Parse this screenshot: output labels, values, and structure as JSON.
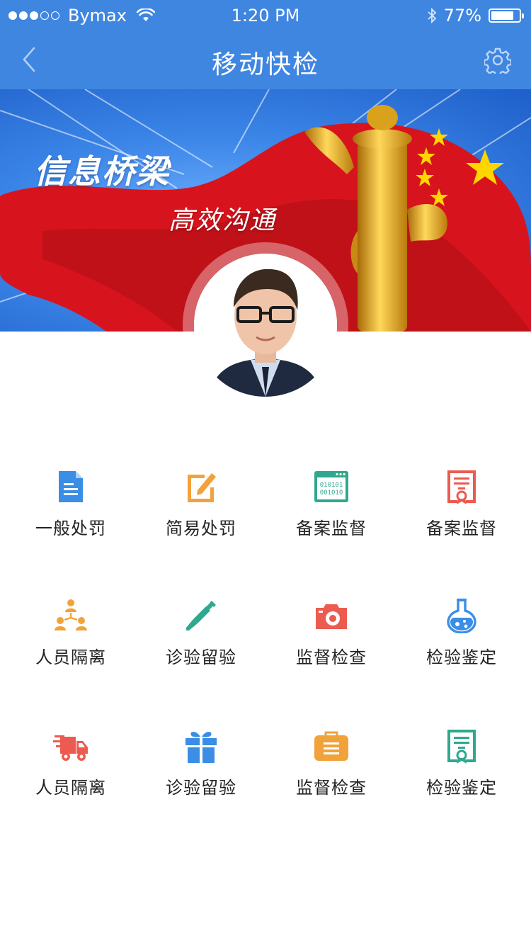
{
  "status_bar": {
    "carrier": "Bymax",
    "time": "1:20 PM",
    "battery_percent": "77%",
    "battery_level": 0.77,
    "signal_dots_filled": 3,
    "signal_dots_total": 5
  },
  "nav": {
    "title": "移动快检",
    "back_icon": "chevron-left-icon",
    "settings_icon": "gear-icon"
  },
  "banner": {
    "slogan_main": "信息桥梁",
    "slogan_sub": "高效沟通"
  },
  "colors": {
    "primary": "#3f86e1",
    "blue": "#3a8ee6",
    "orange": "#f2a23a",
    "teal": "#2fa88f",
    "red": "#ec5b4f"
  },
  "menu": {
    "rows": [
      [
        {
          "label": "一般处罚",
          "icon": "document-icon"
        },
        {
          "label": "简易处罚",
          "icon": "edit-icon"
        },
        {
          "label": "备案监督",
          "icon": "binary-code-icon"
        },
        {
          "label": "备案监督",
          "icon": "certificate-icon"
        }
      ],
      [
        {
          "label": "人员隔离",
          "icon": "people-network-icon"
        },
        {
          "label": "诊验留验",
          "icon": "syringe-icon"
        },
        {
          "label": "监督检查",
          "icon": "camera-icon"
        },
        {
          "label": "检验鉴定",
          "icon": "flask-icon"
        }
      ],
      [
        {
          "label": "人员隔离",
          "icon": "delivery-truck-icon"
        },
        {
          "label": "诊验留验",
          "icon": "gift-icon"
        },
        {
          "label": "监督检查",
          "icon": "briefcase-icon"
        },
        {
          "label": "检验鉴定",
          "icon": "certificate-icon"
        }
      ]
    ]
  }
}
